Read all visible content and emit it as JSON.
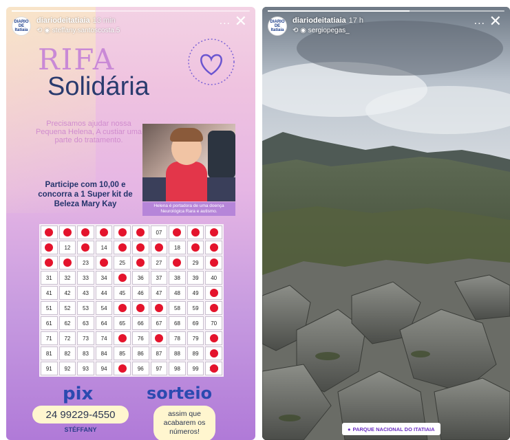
{
  "left_story": {
    "account_name": "diariodeitatiaia",
    "avatar_text": "DIARIO DE Itatiaia",
    "time_ago": "13 min",
    "reposted_from": "steffany.santoscosta.5",
    "progress_fraction": 0.35,
    "more_label": "...",
    "close_label": "✕",
    "poster": {
      "title_line1": "RIFA",
      "title_line2": "Solidária",
      "message": "Precisamos ajudar nossa Pequena Helena, A custiar uma parte do tratamento.",
      "photo_caption": "Helena é portadora de uma doença Neurológica Rara e autismo.",
      "offer": "Participe com 10,00 e concorra a 1 Super kit de Beleza Mary Kay",
      "raffle_numbers": [
        "01",
        "02",
        "03",
        "04",
        "05",
        "06",
        "07",
        "08",
        "09",
        "10",
        "11",
        "12",
        "13",
        "14",
        "15",
        "16",
        "17",
        "18",
        "19",
        "20",
        "21",
        "22",
        "23",
        "24",
        "25",
        "26",
        "27",
        "28",
        "29",
        "30",
        "31",
        "32",
        "33",
        "34",
        "35",
        "36",
        "37",
        "38",
        "39",
        "40",
        "41",
        "42",
        "43",
        "44",
        "45",
        "46",
        "47",
        "48",
        "49",
        "50",
        "51",
        "52",
        "53",
        "54",
        "55",
        "56",
        "57",
        "58",
        "59",
        "60",
        "61",
        "62",
        "63",
        "64",
        "65",
        "66",
        "67",
        "68",
        "69",
        "70",
        "71",
        "72",
        "73",
        "74",
        "75",
        "76",
        "77",
        "78",
        "79",
        "80",
        "81",
        "82",
        "83",
        "84",
        "85",
        "86",
        "87",
        "88",
        "89",
        "90",
        "91",
        "92",
        "93",
        "94",
        "95",
        "96",
        "97",
        "98",
        "99",
        "100"
      ],
      "sold_numbers": [
        1,
        2,
        3,
        4,
        5,
        6,
        8,
        9,
        10,
        11,
        13,
        15,
        16,
        17,
        19,
        20,
        21,
        22,
        24,
        26,
        28,
        30,
        35,
        50,
        55,
        56,
        57,
        60,
        75,
        77,
        80,
        90,
        95,
        100
      ],
      "pix_label": "pix",
      "phone": "24 99229-4550",
      "contact_name": "STÉFFANY",
      "draw_label": "sorteio",
      "draw_note": "assim que acabarem os números!"
    }
  },
  "right_story": {
    "account_name": "diariodeitatiaia",
    "avatar_text": "DIARIO DE Itatiaia",
    "time_ago": "17 h",
    "reposted_from": "sergiopegas_",
    "progress_fraction": 0.6,
    "more_label": "...",
    "close_label": "✕",
    "location_sticker": "PARQUE NACIONAL DO ITATIAIA"
  },
  "colors": {
    "accent_blue": "#2b4ab0",
    "raffle_mark_red": "#e4132c",
    "location_purple": "#6b2fc1"
  }
}
